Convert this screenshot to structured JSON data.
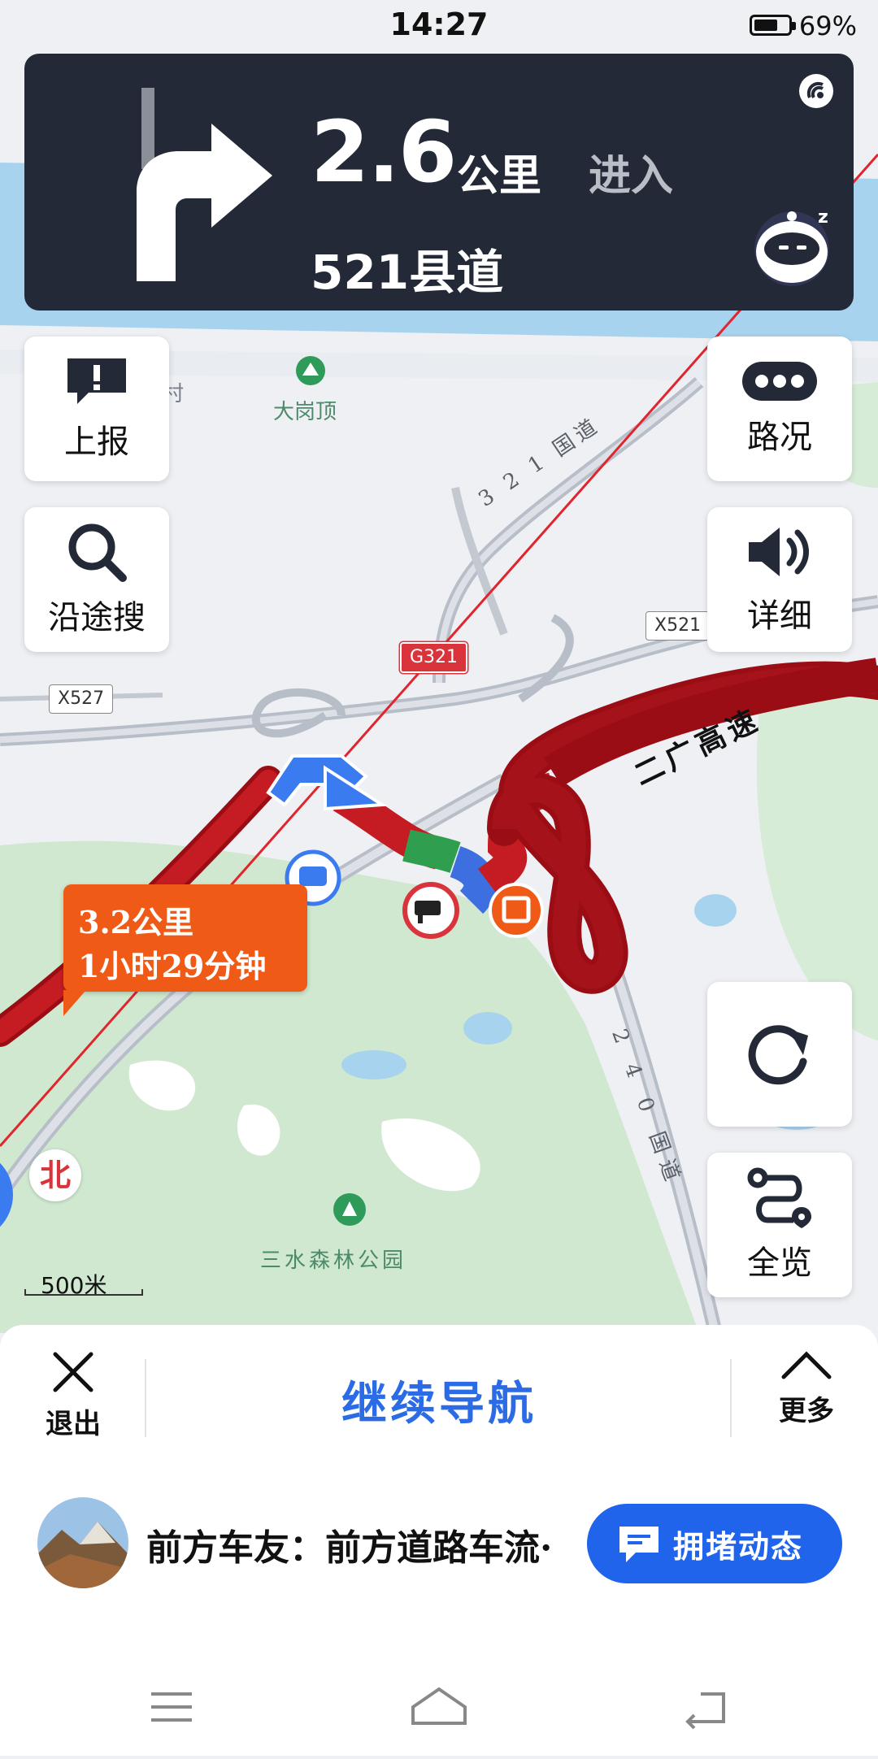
{
  "status_bar": {
    "time": "14:27",
    "battery_percent": "69%",
    "battery_level": 0.69
  },
  "guidance": {
    "distance": "2.6",
    "unit": "公里",
    "action": "进入",
    "road_name": "521县道",
    "turn_direction": "right",
    "icons": [
      "signal-icon",
      "assistant-robot-icon"
    ]
  },
  "left_buttons": [
    {
      "label": "上报",
      "icon": "report-icon"
    },
    {
      "label": "沿途搜",
      "icon": "search-icon"
    }
  ],
  "right_buttons": [
    {
      "label": "路况",
      "icon": "traffic-icon"
    },
    {
      "label": "详细",
      "icon": "speaker-icon"
    },
    {
      "label": "",
      "icon": "refresh-icon"
    },
    {
      "label": "全览",
      "icon": "route-overview-icon"
    }
  ],
  "map": {
    "poi_peak": "大岗顶",
    "poi_park": "三水森林公园",
    "village_fragment": "村",
    "road_321": "3 2 1 国道",
    "road_240": "2 4 0 国道",
    "expressway": "二广高速",
    "badge_g321": "G321",
    "badge_x521": "X521",
    "badge_x527": "X527",
    "compass": "北",
    "scale": "500米"
  },
  "route_tooltip": {
    "distance": "3.2公里",
    "duration": "1小时29分钟"
  },
  "bottom_panel": {
    "exit_label": "退出",
    "continue_label": "继续导航",
    "more_label": "更多",
    "message": "前方车友：前方道路车流·",
    "jam_button": "拥堵动态"
  },
  "system_nav": [
    "menu-icon",
    "home-icon",
    "back-icon"
  ]
}
